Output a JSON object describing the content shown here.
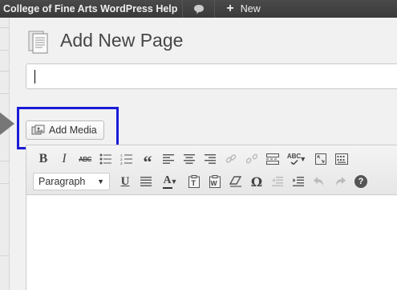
{
  "admin_bar": {
    "site_name": "College of Fine Arts WordPress Help",
    "comments_icon": "speech-bubble-icon",
    "new_icon": "plus-icon",
    "new_label": "New"
  },
  "header": {
    "icon": "pages-icon",
    "title": "Add New Page"
  },
  "title_field": {
    "value": "",
    "placeholder": ""
  },
  "media": {
    "add_media_label": "Add Media",
    "icon": "media-icon"
  },
  "editor": {
    "row1": [
      "bold-icon",
      "italic-icon",
      "strikethrough-icon",
      "bullet-list-icon",
      "numbered-list-icon",
      "blockquote-icon",
      "align-left-icon",
      "align-center-icon",
      "align-right-icon",
      "insert-link-icon",
      "unlink-icon",
      "read-more-icon",
      "spellcheck-icon",
      "fullscreen-icon",
      "toolbar-toggle-icon"
    ],
    "row2": [
      "underline-icon",
      "align-justify-icon",
      "text-color-icon",
      "paste-as-text-icon",
      "paste-from-word-icon",
      "clear-formatting-icon",
      "special-character-icon",
      "outdent-icon",
      "indent-icon",
      "undo-icon",
      "redo-icon",
      "help-icon"
    ],
    "format_select": "Paragraph",
    "bold_glyph": "B",
    "italic_glyph": "I",
    "strike_glyph": "ABC",
    "spell_glyph": "ABC",
    "quote_glyph": "“",
    "underline_glyph": "U",
    "textcolor_glyph": "A",
    "omega_glyph": "Ω",
    "help_glyph": "?"
  },
  "colors": {
    "admin_bar_bg": "#464646",
    "highlight_border": "#1a1ad8",
    "page_bg": "#f1f1f1"
  }
}
